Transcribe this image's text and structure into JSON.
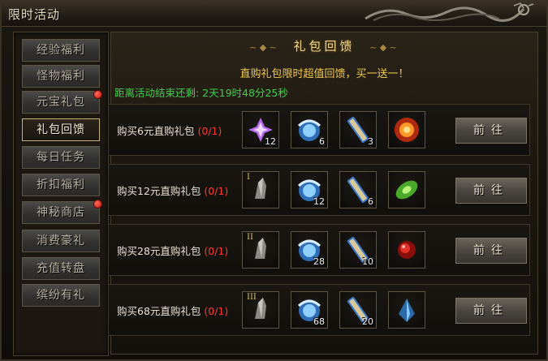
{
  "window": {
    "title": "限时活动"
  },
  "sidebar": {
    "items": [
      {
        "label": "经验福利",
        "active": false,
        "badge": false
      },
      {
        "label": "怪物福利",
        "active": false,
        "badge": false
      },
      {
        "label": "元宝礼包",
        "active": false,
        "badge": true
      },
      {
        "label": "礼包回馈",
        "active": true,
        "badge": false
      },
      {
        "label": "每日任务",
        "active": false,
        "badge": false
      },
      {
        "label": "折扣福利",
        "active": false,
        "badge": false
      },
      {
        "label": "神秘商店",
        "active": false,
        "badge": true
      },
      {
        "label": "消费豪礼",
        "active": false,
        "badge": false
      },
      {
        "label": "充值转盘",
        "active": false,
        "badge": false
      },
      {
        "label": "缤纷有礼",
        "active": false,
        "badge": false
      }
    ]
  },
  "main": {
    "title": "礼包回馈",
    "subtitle": "直购礼包限时超值回馈，买一送一！",
    "timer": "距离活动结束还剩: 2天19时48分25秒",
    "packs": [
      {
        "label": "购买6元直购礼包",
        "progress": "(0/1)",
        "button": "前往",
        "items": [
          {
            "icon": "purple-gem-icon",
            "qty": "12",
            "tier": ""
          },
          {
            "icon": "blue-dragon-orb-icon",
            "qty": "6",
            "tier": ""
          },
          {
            "icon": "scroll-icon",
            "qty": "3",
            "tier": ""
          },
          {
            "icon": "fire-orb-icon",
            "qty": "",
            "tier": ""
          }
        ]
      },
      {
        "label": "购买12元直购礼包",
        "progress": "(0/1)",
        "button": "前往",
        "items": [
          {
            "icon": "ore-shard-icon",
            "qty": "",
            "tier": "I"
          },
          {
            "icon": "blue-dragon-orb-icon",
            "qty": "12",
            "tier": ""
          },
          {
            "icon": "scroll-icon",
            "qty": "6",
            "tier": ""
          },
          {
            "icon": "green-jade-icon",
            "qty": "",
            "tier": ""
          }
        ]
      },
      {
        "label": "购买28元直购礼包",
        "progress": "(0/1)",
        "button": "前往",
        "items": [
          {
            "icon": "ore-shard-icon",
            "qty": "",
            "tier": "II"
          },
          {
            "icon": "blue-dragon-orb-icon",
            "qty": "28",
            "tier": ""
          },
          {
            "icon": "scroll-icon",
            "qty": "10",
            "tier": ""
          },
          {
            "icon": "red-bead-icon",
            "qty": "",
            "tier": ""
          }
        ]
      },
      {
        "label": "购买68元直购礼包",
        "progress": "(0/1)",
        "button": "前往",
        "items": [
          {
            "icon": "ore-shard-icon",
            "qty": "",
            "tier": "III"
          },
          {
            "icon": "blue-dragon-orb-icon",
            "qty": "68",
            "tier": ""
          },
          {
            "icon": "scroll-icon",
            "qty": "20",
            "tier": ""
          },
          {
            "icon": "blue-crystal-icon",
            "qty": "",
            "tier": ""
          }
        ]
      }
    ]
  },
  "colors": {
    "accent_gold": "#f0c94b",
    "timer_green": "#3ed24a",
    "progress_red": "#ff3b2f",
    "badge_red": "#d8180c"
  }
}
